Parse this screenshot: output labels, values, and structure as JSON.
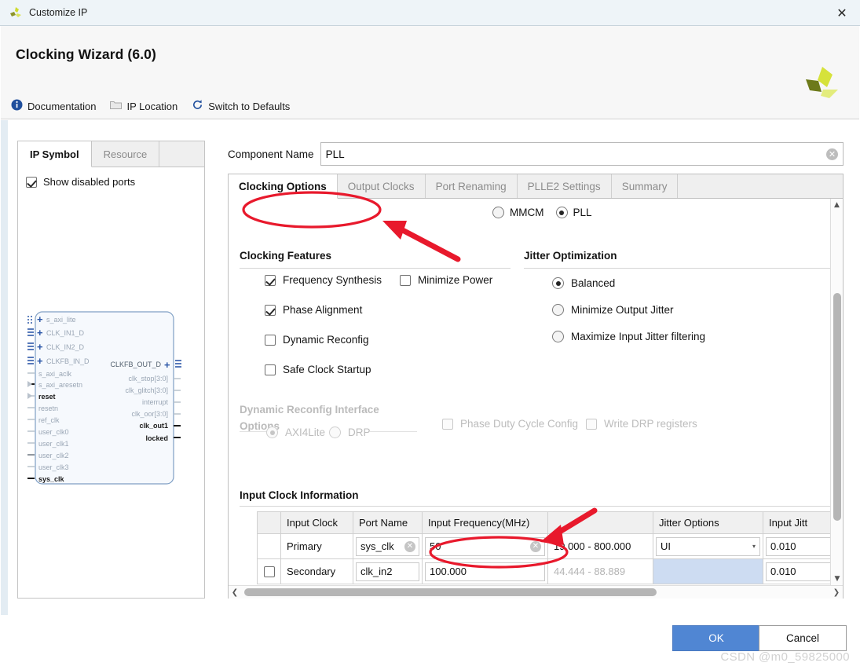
{
  "window": {
    "title": "Customize IP",
    "close_icon": "close-icon",
    "app_icon": "xilinx-logo-icon"
  },
  "header": {
    "title": "Clocking Wizard (6.0)",
    "logo_icon": "xilinx-pinwheel-logo"
  },
  "toolbar": {
    "items": [
      {
        "label": "Documentation",
        "icon": "info-icon"
      },
      {
        "label": "IP Location",
        "icon": "folder-icon"
      },
      {
        "label": "Switch to Defaults",
        "icon": "refresh-icon"
      }
    ]
  },
  "left_panel": {
    "tabs": [
      {
        "label": "IP Symbol",
        "active": true
      },
      {
        "label": "Resource",
        "active": false
      }
    ],
    "show_disabled_ports": {
      "label": "Show disabled ports",
      "checked": true
    },
    "symbol": {
      "inputs_bus": [
        "s_axi_lite",
        "CLK_IN1_D",
        "CLK_IN2_D",
        "CLKFB_IN_D"
      ],
      "inputs_single": [
        {
          "name": "s_axi_aclk",
          "enabled": false
        },
        {
          "name": "s_axi_aresetn",
          "enabled": false
        },
        {
          "name": "reset",
          "enabled": true
        },
        {
          "name": "resetn",
          "enabled": false
        },
        {
          "name": "ref_clk",
          "enabled": false
        },
        {
          "name": "user_clk0",
          "enabled": false
        },
        {
          "name": "user_clk1",
          "enabled": false
        },
        {
          "name": "user_clk2",
          "enabled": false
        },
        {
          "name": "user_clk3",
          "enabled": false
        },
        {
          "name": "sys_clk",
          "enabled": true
        }
      ],
      "outputs_bus": [
        "CLKFB_OUT_D"
      ],
      "outputs_single": [
        {
          "name": "clk_stop[3:0]",
          "enabled": false
        },
        {
          "name": "clk_glitch[3:0]",
          "enabled": false
        },
        {
          "name": "interrupt",
          "enabled": false
        },
        {
          "name": "clk_oor[3:0]",
          "enabled": false
        },
        {
          "name": "clk_out1",
          "enabled": true
        },
        {
          "name": "locked",
          "enabled": true
        }
      ]
    }
  },
  "component": {
    "label": "Component Name",
    "value": "PLL",
    "placeholder": "",
    "clear_icon": "clear-circle-icon"
  },
  "tabs": [
    {
      "label": "Clocking Options",
      "active": true
    },
    {
      "label": "Output Clocks",
      "active": false
    },
    {
      "label": "Port Renaming",
      "active": false
    },
    {
      "label": "PLLE2 Settings",
      "active": false
    },
    {
      "label": "Summary",
      "active": false
    }
  ],
  "clocking_options": {
    "primitive": {
      "options": [
        {
          "label": "MMCM",
          "selected": false
        },
        {
          "label": "PLL",
          "selected": true
        }
      ]
    },
    "clocking_features": {
      "title": "Clocking Features",
      "items": [
        {
          "label": "Frequency Synthesis",
          "checked": true
        },
        {
          "label": "Minimize Power",
          "checked": false
        },
        {
          "label": "Phase Alignment",
          "checked": true
        },
        {
          "label": "Dynamic Reconfig",
          "checked": false
        },
        {
          "label": "Safe Clock Startup",
          "checked": false
        }
      ]
    },
    "jitter_optimization": {
      "title": "Jitter Optimization",
      "options": [
        {
          "label": "Balanced",
          "selected": true
        },
        {
          "label": "Minimize Output Jitter",
          "selected": false
        },
        {
          "label": "Maximize Input Jitter filtering",
          "selected": false
        }
      ]
    },
    "dynamic_reconfig": {
      "title_line1": "Dynamic Reconfig Interface",
      "title_line2": "Options",
      "disabled": true,
      "radios": [
        {
          "label": "AXI4Lite",
          "selected": true
        },
        {
          "label": "DRP",
          "selected": false
        }
      ],
      "checkboxes": [
        {
          "label": "Phase Duty Cycle Config",
          "checked": false
        },
        {
          "label": "Write DRP registers",
          "checked": false
        }
      ]
    },
    "input_clock_information": {
      "title": "Input Clock Information",
      "columns": [
        "",
        "Input Clock",
        "Port Name",
        "Input Frequency(MHz)",
        "",
        "Jitter Options",
        "Input Jitt"
      ],
      "rows": [
        {
          "enabled_checkbox": null,
          "input_clock": "Primary",
          "port_name": "sys_clk",
          "input_frequency": "50",
          "freq_range": "19.000 - 800.000",
          "jitter_options": "UI",
          "input_jitter": "0.010",
          "disabled": false
        },
        {
          "enabled_checkbox": false,
          "input_clock": "Secondary",
          "port_name": "clk_in2",
          "input_frequency": "100.000",
          "freq_range": "44.444 - 88.889",
          "jitter_options": "",
          "input_jitter": "0.010",
          "disabled": true
        }
      ]
    }
  },
  "footer": {
    "ok_label": "OK",
    "cancel_label": "Cancel",
    "watermark": "CSDN @m0_59825000"
  },
  "annotations": {
    "color": "#e8192c",
    "ellipse_primitive": "highlight-ellipse-pll-radio",
    "arrow_primitive": "highlight-arrow-pll-radio",
    "ellipse_frequency": "highlight-ellipse-input-frequency",
    "arrow_frequency": "highlight-arrow-input-frequency"
  },
  "colors": {
    "accent_button": "#5086d3",
    "titlebar": "#eef4f8",
    "header": "#f7f7f7",
    "annotation_red": "#e8192c",
    "selected_row_blue": "#cddcf2"
  }
}
